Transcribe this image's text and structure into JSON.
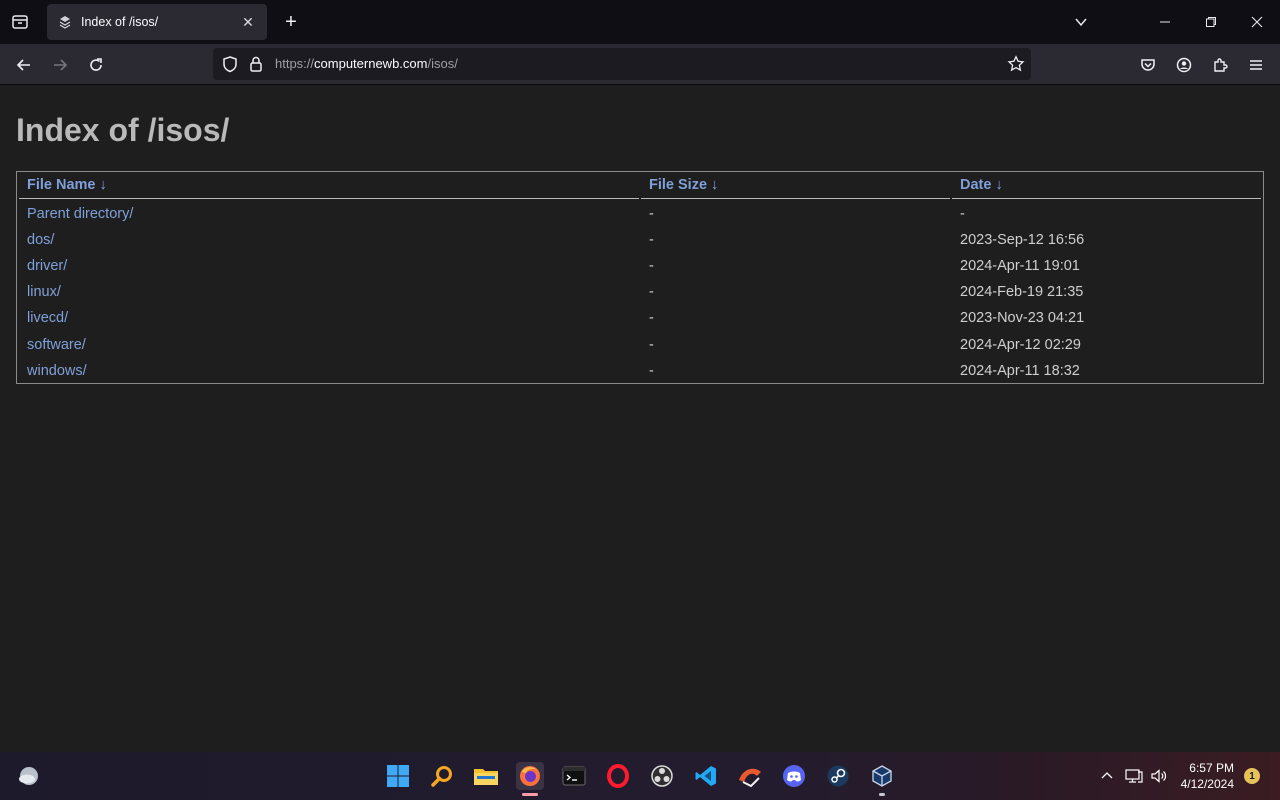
{
  "browser": {
    "tab": {
      "title": "Index of /isos/"
    },
    "url": {
      "prefix": "https://",
      "host": "computernewb.com",
      "path": "/isos/"
    }
  },
  "page": {
    "heading": "Index of /isos/",
    "columns": {
      "name": "File Name  ↓",
      "size": "File Size  ↓",
      "date": "Date  ↓"
    },
    "rows": [
      {
        "name": "Parent directory/",
        "size": "-",
        "date": "-"
      },
      {
        "name": "dos/",
        "size": "-",
        "date": "2023-Sep-12 16:56"
      },
      {
        "name": "driver/",
        "size": "-",
        "date": "2024-Apr-11 19:01"
      },
      {
        "name": "linux/",
        "size": "-",
        "date": "2024-Feb-19 21:35"
      },
      {
        "name": "livecd/",
        "size": "-",
        "date": "2023-Nov-23 04:21"
      },
      {
        "name": "software/",
        "size": "-",
        "date": "2024-Apr-12 02:29"
      },
      {
        "name": "windows/",
        "size": "-",
        "date": "2024-Apr-11 18:32"
      }
    ]
  },
  "taskbar": {
    "time": "6:57 PM",
    "date": "4/12/2024",
    "notifications": "1",
    "apps": [
      "windows-start",
      "search",
      "file-explorer",
      "firefox",
      "terminal",
      "opera",
      "obs",
      "vscode",
      "git-client",
      "discord",
      "steam",
      "virtualbox"
    ]
  },
  "colors": {
    "link": "#7fa0d8",
    "background": "#1e1e1e",
    "chrome": "#2b2a33"
  }
}
